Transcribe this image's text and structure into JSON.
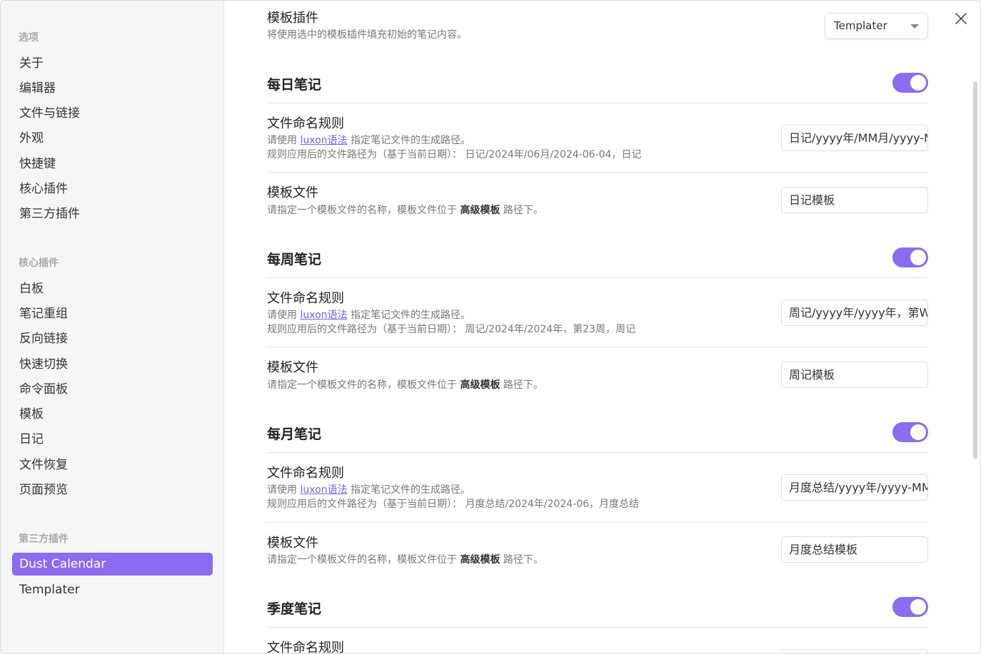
{
  "sidebar": {
    "sections": [
      {
        "heading": "选项",
        "items": [
          "关于",
          "编辑器",
          "文件与链接",
          "外观",
          "快捷键",
          "核心插件",
          "第三方插件"
        ]
      },
      {
        "heading": "核心插件",
        "items": [
          "白板",
          "笔记重组",
          "反向链接",
          "快速切换",
          "命令面板",
          "模板",
          "日记",
          "文件恢复",
          "页面预览"
        ]
      },
      {
        "heading": "第三方插件",
        "items": [
          "Dust Calendar",
          "Templater"
        ]
      }
    ],
    "active_item": "Dust Calendar"
  },
  "template_plugin": {
    "title": "模板插件",
    "desc": "将使用选中的模板插件填充初始的笔记内容。",
    "selected": "Templater"
  },
  "daily": {
    "title": "每日笔记",
    "enabled": true,
    "naming": {
      "title": "文件命名规则",
      "desc_prefix": "请使用",
      "link": "luxon语法",
      "desc_suffix": "指定笔记文件的生成路径。",
      "preview": "规则应用后的文件路径为（基于当前日期）： 日记/2024年/06月/2024-06-04，日记",
      "value": "日记/yyyy年/MM月/yyyy-MM-dd，日记"
    },
    "template": {
      "title": "模板文件",
      "desc_prefix": "请指定一个模板文件的名称，模板文件位于",
      "bold": "高级模板",
      "desc_suffix": "路径下。",
      "value": "日记模板"
    }
  },
  "weekly": {
    "title": "每周笔记",
    "enabled": true,
    "naming": {
      "title": "文件命名规则",
      "desc_prefix": "请使用",
      "link": "luxon语法",
      "desc_suffix": "指定笔记文件的生成路径。",
      "preview": "规则应用后的文件路径为（基于当前日期）： 周记/2024年/2024年，第23周，周记",
      "value": "周记/yyyy年/yyyy年，第W周，周记"
    },
    "template": {
      "title": "模板文件",
      "desc_prefix": "请指定一个模板文件的名称，模板文件位于",
      "bold": "高级模板",
      "desc_suffix": "路径下。",
      "value": "周记模板"
    }
  },
  "monthly": {
    "title": "每月笔记",
    "enabled": true,
    "naming": {
      "title": "文件命名规则",
      "desc_prefix": "请使用",
      "link": "luxon语法",
      "desc_suffix": "指定笔记文件的生成路径。",
      "preview": "规则应用后的文件路径为（基于当前日期）： 月度总结/2024年/2024-06，月度总结",
      "value": "月度总结/yyyy年/yyyy-MM，月度总结"
    },
    "template": {
      "title": "模板文件",
      "desc_prefix": "请指定一个模板文件的名称，模板文件位于",
      "bold": "高级模板",
      "desc_suffix": "路径下。",
      "value": "月度总结模板"
    }
  },
  "quarterly": {
    "title": "季度笔记",
    "enabled": true,
    "naming": {
      "title": "文件命名规则"
    }
  },
  "colors": {
    "accent": "#8b6cef"
  },
  "icons": {
    "close": "close-icon",
    "dropdown": "chevron-down-icon"
  }
}
